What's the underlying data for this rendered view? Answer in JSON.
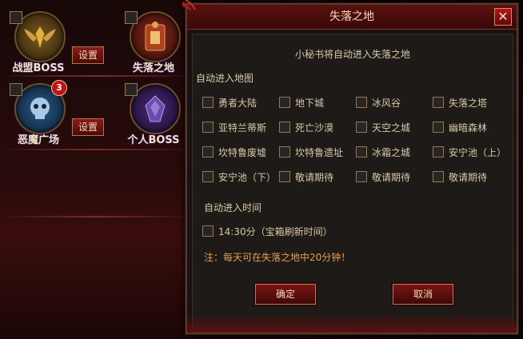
{
  "left_panel": {
    "features": [
      {
        "name": "战盟BOSS",
        "icon": "wings-emblem-icon",
        "button": "设置"
      },
      {
        "name": "失落之地",
        "icon": "gate-emblem-icon"
      },
      {
        "name": "恶魔广场",
        "icon": "skull-emblem-icon",
        "button": "设置",
        "badge": "3"
      },
      {
        "name": "个人BOSS",
        "icon": "dark-crystal-emblem-icon"
      }
    ]
  },
  "dialog": {
    "title": "失落之地",
    "subtitle": "小秘书将自动进入失落之地",
    "map_section_label": "自动进入地图",
    "maps": [
      [
        "勇者大陆",
        "地下城",
        "冰风谷",
        "失落之塔"
      ],
      [
        "亚特兰蒂斯",
        "死亡沙漠",
        "天空之城",
        "幽暗森林"
      ],
      [
        "坎特鲁废墟",
        "坎特鲁遗址",
        "冰霜之城",
        "安宁池（上）"
      ],
      [
        "安宁池（下）",
        "敬请期待",
        "敬请期待",
        "敬请期待"
      ]
    ],
    "time_section_label": "自动进入时间",
    "time_option": "14:30分（宝箱刷新时间）",
    "note": "注：每天可在失落之地中20分钟！",
    "confirm_label": "确定",
    "cancel_label": "取消"
  },
  "colors": {
    "accent_red": "#7a1414",
    "gold_text": "#f0dcb4",
    "note_orange": "#e2a050"
  }
}
